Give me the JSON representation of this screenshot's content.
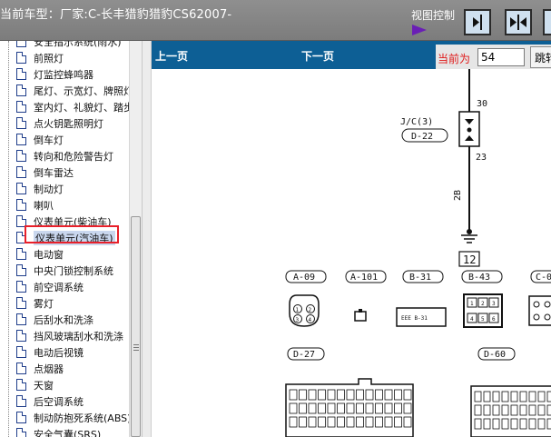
{
  "header": {
    "vehicle_info": "当前车型：厂家:C-长丰猎豹猎豹CS62007-",
    "view_control_label": "视图控制",
    "view_buttons": [
      "collapse-left-icon",
      "split-view-icon",
      "expand-right-icon"
    ]
  },
  "sidebar": {
    "items": [
      {
        "label": "安全指示系统(雨水)"
      },
      {
        "label": "前照灯"
      },
      {
        "label": "灯监控蜂鸣器"
      },
      {
        "label": "尾灯、示宽灯、牌照灯"
      },
      {
        "label": "室内灯、礼貌灯、踏步灯"
      },
      {
        "label": "点火钥匙照明灯"
      },
      {
        "label": "倒车灯"
      },
      {
        "label": "转向和危险警告灯"
      },
      {
        "label": "倒车雷达"
      },
      {
        "label": "制动灯"
      },
      {
        "label": "喇叭"
      },
      {
        "label": "仪表单元(柴油车)"
      },
      {
        "label": "仪表单元(汽油车)",
        "selected": true
      },
      {
        "label": "电动窗"
      },
      {
        "label": "中央门锁控制系统"
      },
      {
        "label": "前空调系统"
      },
      {
        "label": "雾灯"
      },
      {
        "label": "后刮水和洗涤"
      },
      {
        "label": "挡风玻璃刮水和洗涤"
      },
      {
        "label": "电动后视镜"
      },
      {
        "label": "点烟器"
      },
      {
        "label": "天窗"
      },
      {
        "label": "后空调系统"
      },
      {
        "label": "制动防抱死系统(ABS)"
      },
      {
        "label": "安全气囊(SRS)"
      }
    ]
  },
  "viewer": {
    "prev_page": "上一页",
    "next_page": "下一页",
    "current_page_label": "当前为",
    "current_page_value": "54",
    "jump_button": "跳转"
  },
  "diagram": {
    "wire_number_top": "30",
    "junction_label": "J/C(3)",
    "junction_code": "D-22",
    "wire_number_mid": "23",
    "wire_color": "2B",
    "ground_number": "12",
    "connectors_row1": [
      "A-09",
      "A-101",
      "B-31",
      "B-43",
      "C-0"
    ],
    "connector_b31_text": "EEE B-31",
    "connectors_row2": [
      "D-27",
      "D-60"
    ],
    "plug_pins": [
      "1",
      "2",
      "3",
      "4"
    ],
    "b43_pins": [
      "1",
      "2",
      "3",
      "4",
      "5",
      "6"
    ]
  }
}
